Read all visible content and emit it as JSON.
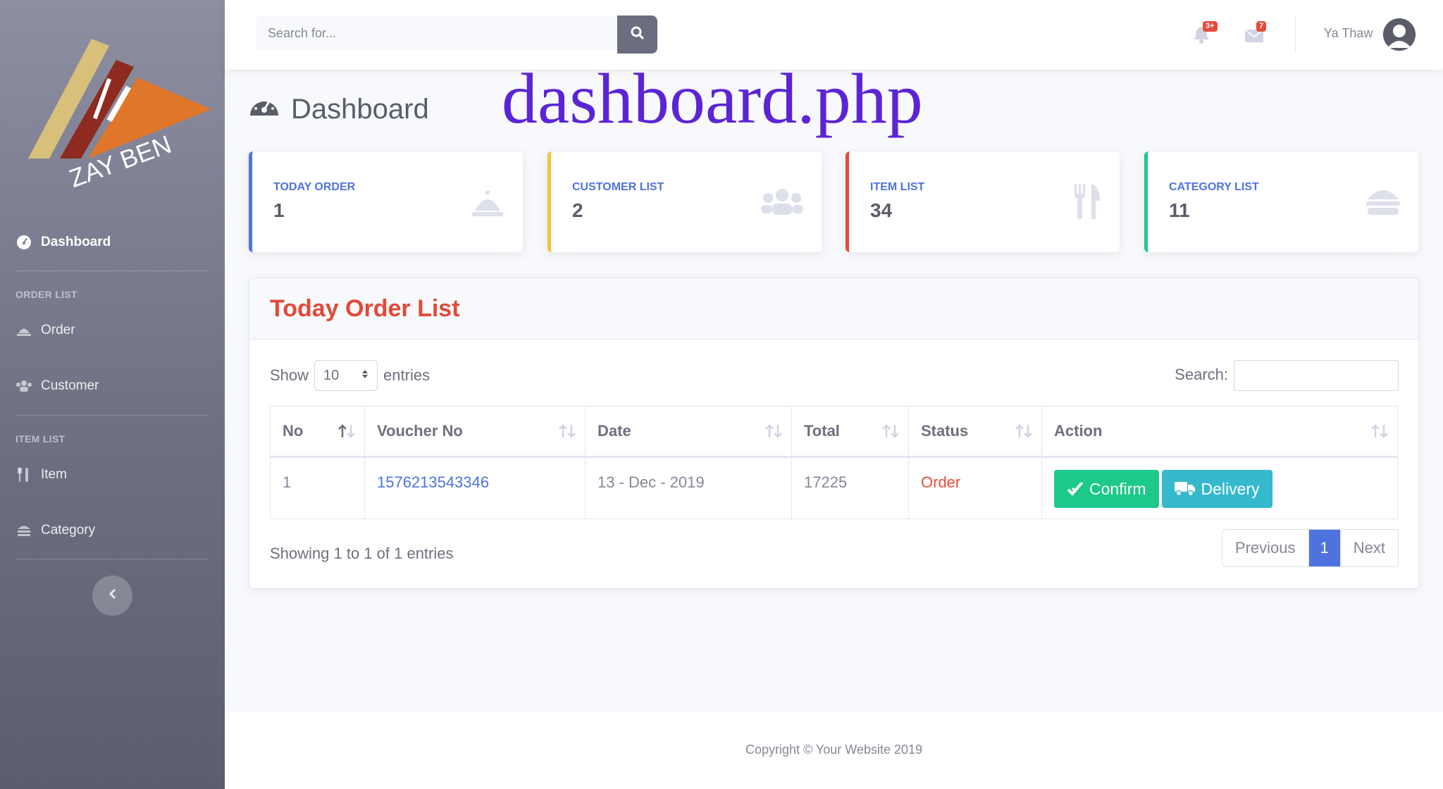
{
  "sidebar": {
    "brand": "ZAY BEN",
    "dashboard_label": "Dashboard",
    "heading_orders": "ORDER LIST",
    "order_label": "Order",
    "customer_label": "Customer",
    "heading_items": "ITEM LIST",
    "item_label": "Item",
    "category_label": "Category"
  },
  "topbar": {
    "search_placeholder": "Search for...",
    "alerts_badge": "3+",
    "messages_badge": "7",
    "user_name": "Ya Thaw"
  },
  "page": {
    "title": "Dashboard",
    "overlay_text": "dashboard.php"
  },
  "cards": [
    {
      "label": "TODAY ORDER",
      "value": "1",
      "color": "#4e73df",
      "icon": "service-bell-icon"
    },
    {
      "label": "CUSTOMER LIST",
      "value": "2",
      "color": "#f6c23e",
      "icon": "users-icon"
    },
    {
      "label": "ITEM LIST",
      "value": "34",
      "color": "#e74a3b",
      "icon": "utensils-icon"
    },
    {
      "label": "CATEGORY LIST",
      "value": "11",
      "color": "#1cc88a",
      "icon": "hamburger-icon"
    }
  ],
  "orders_panel": {
    "title": "Today Order List",
    "show_label": "Show",
    "entries_value": "10",
    "entries_label": "entries",
    "search_label": "Search:",
    "columns": [
      "No",
      "Voucher No",
      "Date",
      "Total",
      "Status",
      "Action"
    ],
    "rows": [
      {
        "no": "1",
        "voucher": "1576213543346",
        "date": "13 - Dec - 2019",
        "total": "17225",
        "status": "Order"
      }
    ],
    "confirm_label": "Confirm",
    "delivery_label": "Delivery",
    "showing_text": "Showing 1 to 1 of 1 entries",
    "pagination": {
      "previous": "Previous",
      "current": "1",
      "next": "Next"
    }
  },
  "footer": {
    "copyright": "Copyright © Your Website 2019"
  }
}
